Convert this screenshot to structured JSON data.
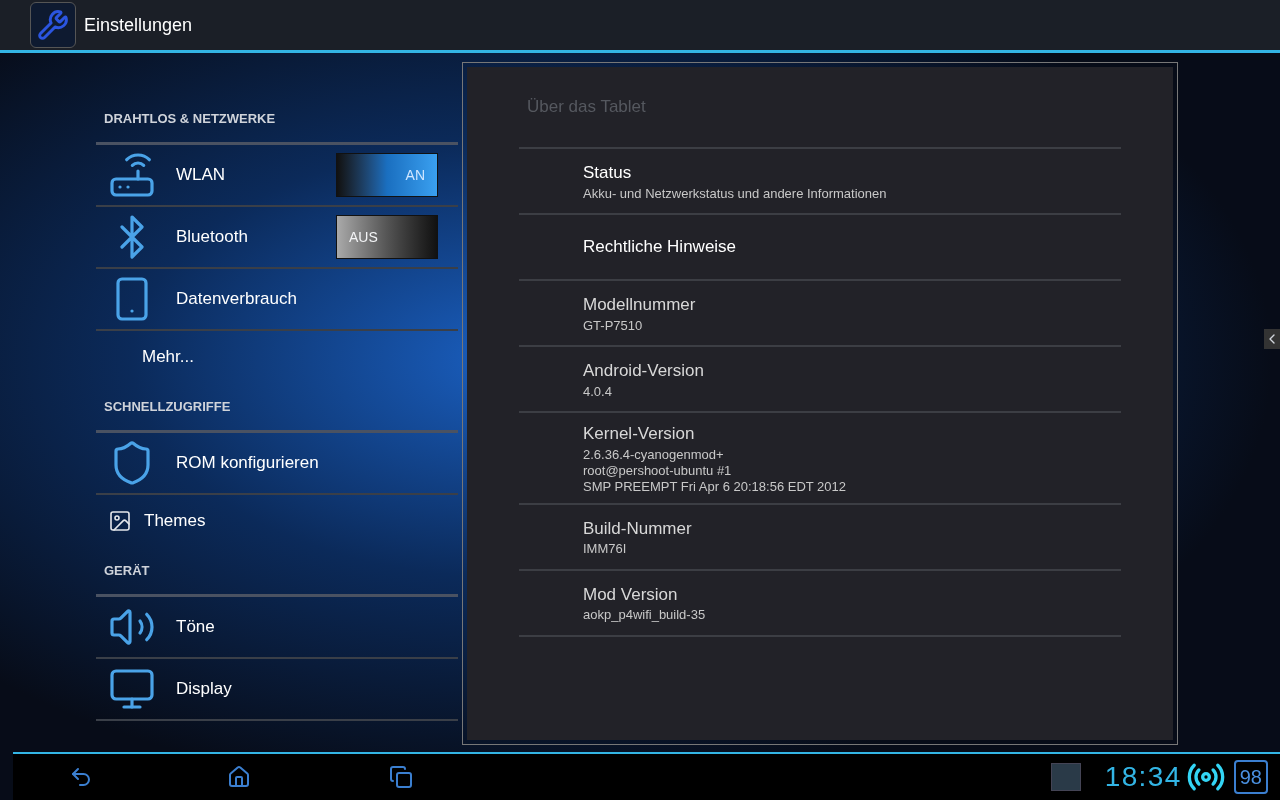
{
  "action_bar": {
    "title": "Einstellungen"
  },
  "sidebar": {
    "sections": [
      {
        "header": "DRAHTLOS & NETZWERKE",
        "items": [
          {
            "label": "WLAN",
            "kind": "toggle",
            "on": true,
            "toggle_label": "AN"
          },
          {
            "label": "Bluetooth",
            "kind": "toggle",
            "on": false,
            "toggle_label": "AUS"
          },
          {
            "label": "Datenverbrauch",
            "kind": "icon"
          },
          {
            "label": "Mehr...",
            "kind": "plain"
          }
        ]
      },
      {
        "header": "SCHNELLZUGRIFFE",
        "items": [
          {
            "label": "ROM konfigurieren",
            "kind": "icon"
          },
          {
            "label": "Themes",
            "kind": "small"
          }
        ]
      },
      {
        "header": "GERÄT",
        "items": [
          {
            "label": "Töne",
            "kind": "icon"
          },
          {
            "label": "Display",
            "kind": "icon"
          }
        ]
      }
    ]
  },
  "detail": {
    "title": "Über das Tablet",
    "rows": [
      {
        "title": "Status",
        "summary": [
          "Akku- und Netzwerkstatus und andere Informationen"
        ]
      },
      {
        "title": "Rechtliche Hinweise"
      },
      {
        "title": "Modellnummer",
        "summary": [
          "GT-P7510"
        ]
      },
      {
        "title": "Android-Version",
        "summary": [
          "4.0.4"
        ]
      },
      {
        "title": "Kernel-Version",
        "summary": [
          "2.6.36.4-cyanogenmod+",
          "root@pershoot-ubuntu #1",
          "SMP PREEMPT Fri Apr 6 20:18:56 EDT 2012"
        ]
      },
      {
        "title": "Build-Nummer",
        "summary": [
          "IMM76I"
        ]
      },
      {
        "title": "Mod Version",
        "summary": [
          "aokp_p4wifi_build-35"
        ]
      }
    ]
  },
  "system_bar": {
    "clock": "18:34",
    "battery": "98"
  }
}
